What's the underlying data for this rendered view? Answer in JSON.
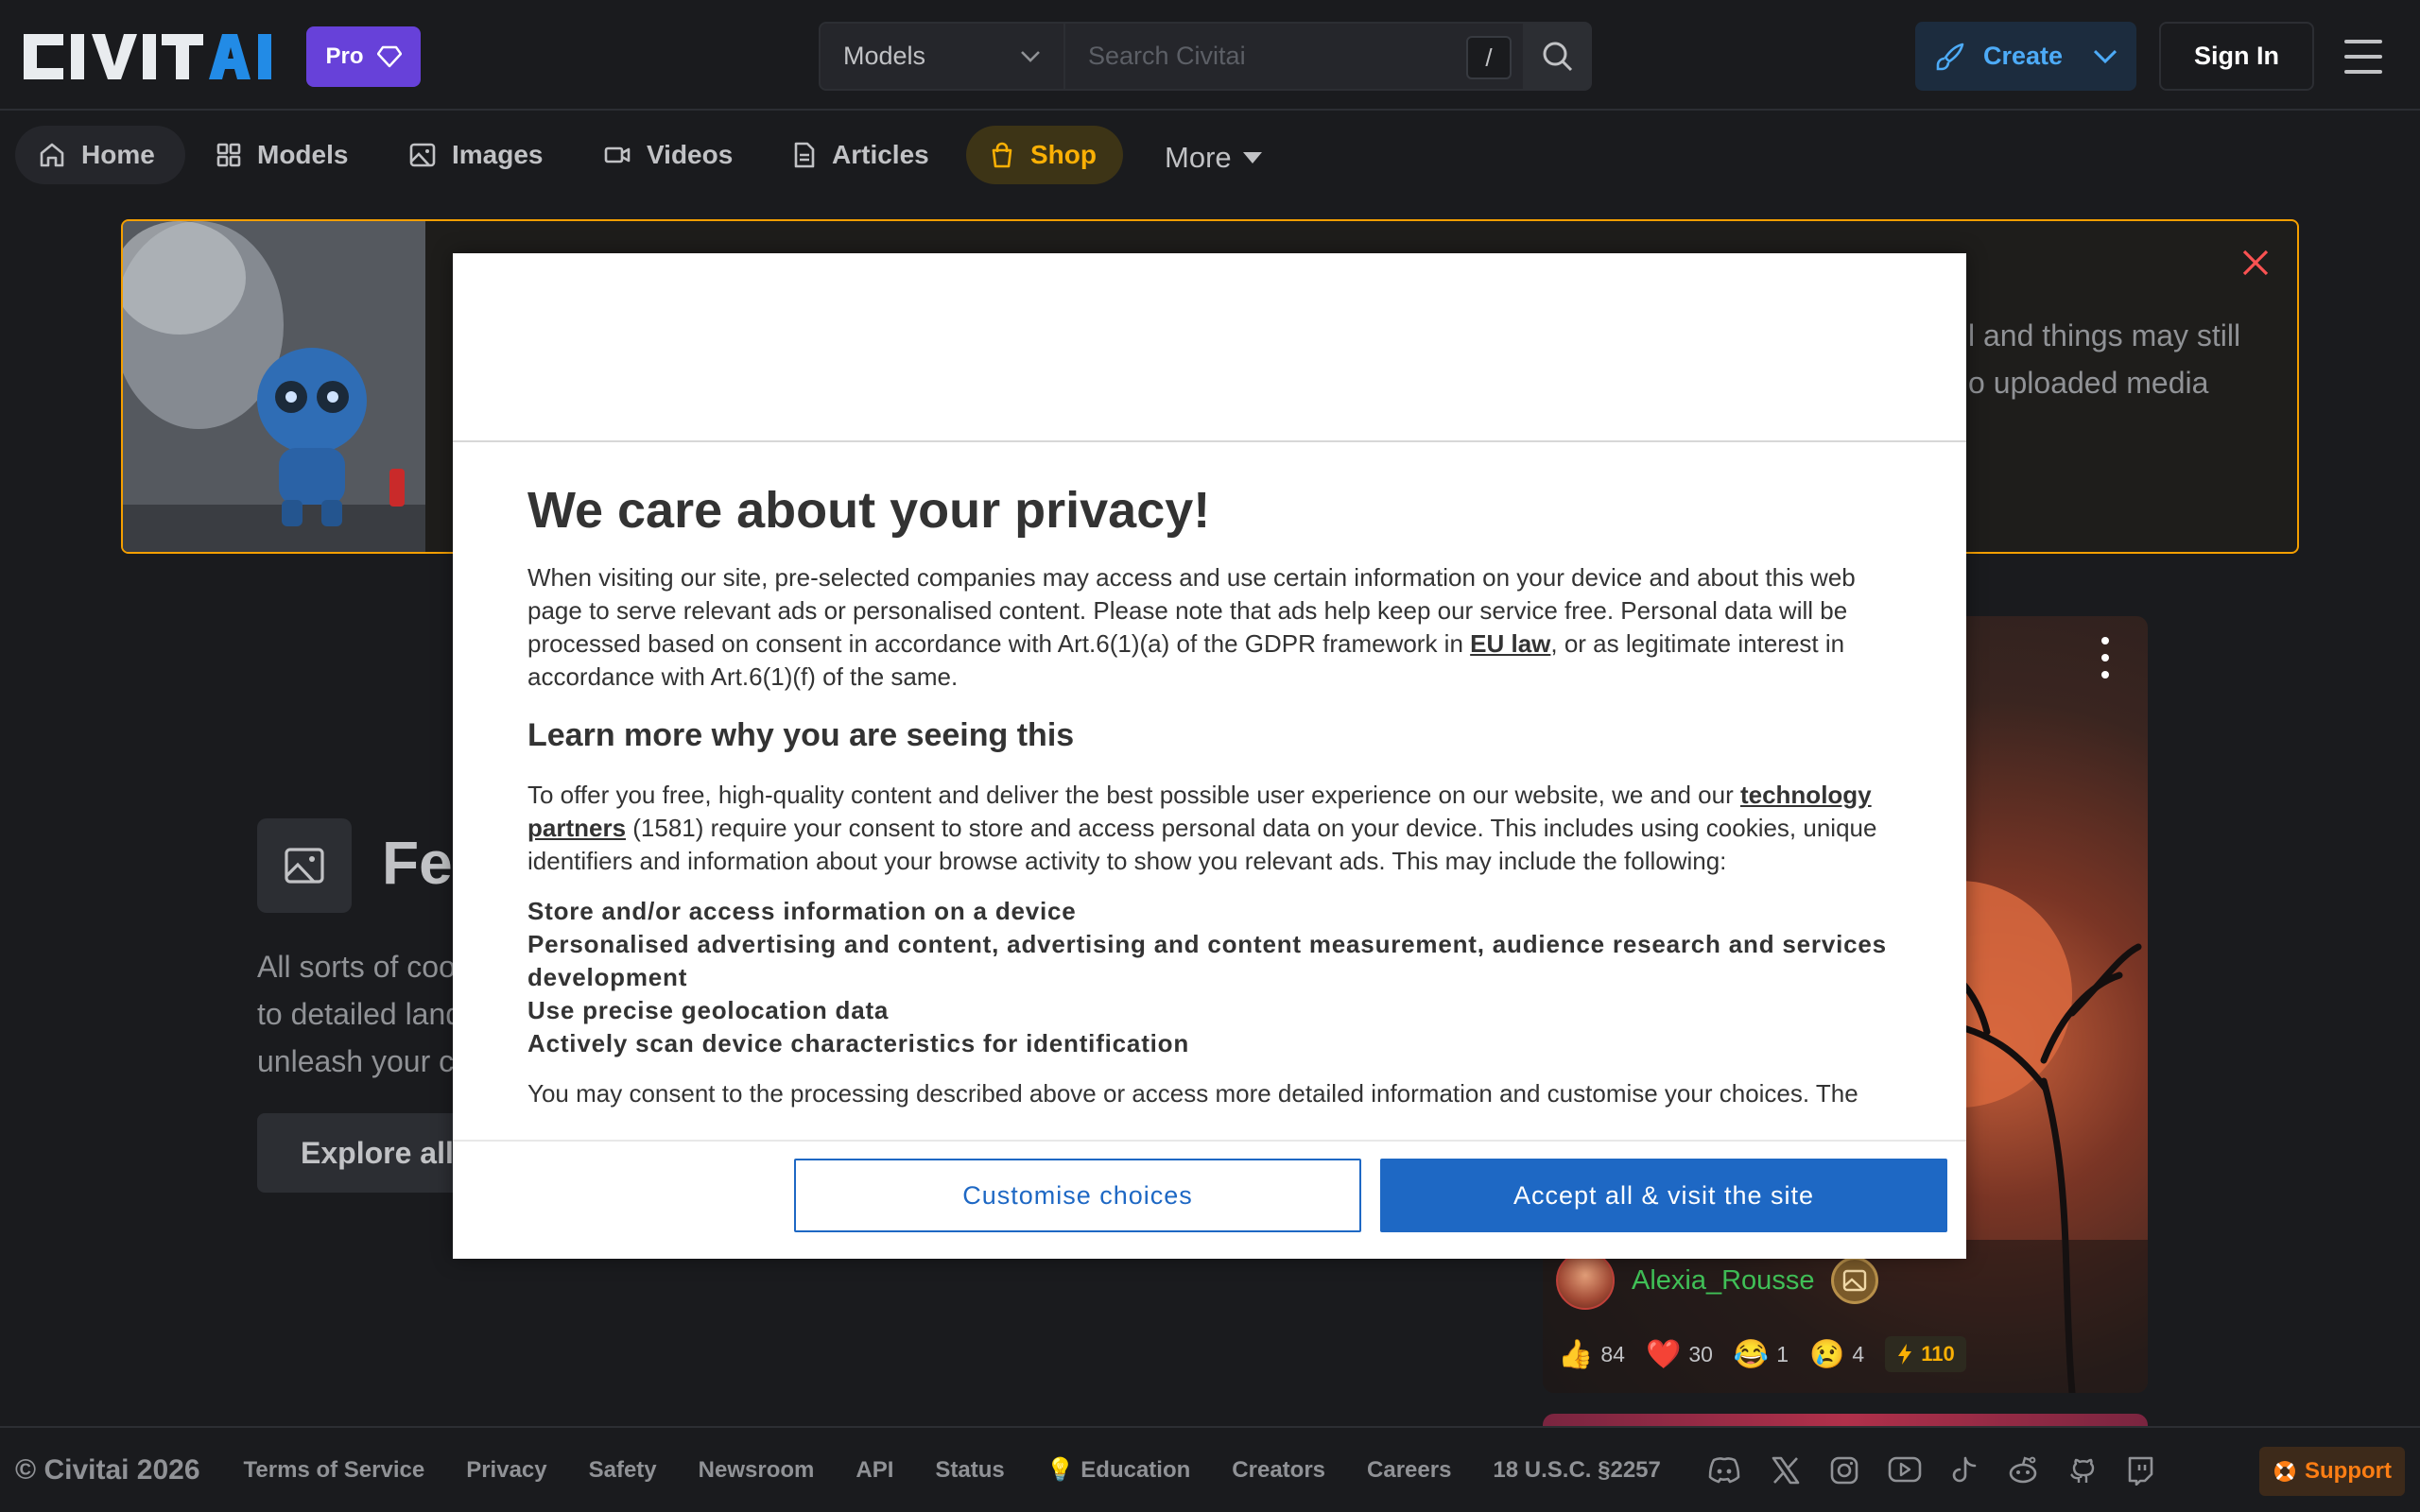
{
  "header": {
    "logo_text": "CIVITAI",
    "pro_label": "Pro",
    "search_scope": "Models",
    "search_placeholder": "Search Civitai",
    "search_shortcut": "/",
    "create_label": "Create",
    "signin_label": "Sign In"
  },
  "nav": {
    "items": [
      {
        "label": "Home",
        "icon": "home-icon"
      },
      {
        "label": "Models",
        "icon": "grid-icon"
      },
      {
        "label": "Images",
        "icon": "photo-icon"
      },
      {
        "label": "Videos",
        "icon": "video-icon"
      },
      {
        "label": "Articles",
        "icon": "article-icon"
      },
      {
        "label": "Shop",
        "icon": "shopping-bag-icon"
      }
    ],
    "more_label": "More"
  },
  "banner": {
    "text_line1": "l and things may still",
    "text_line2": "o uploaded media"
  },
  "featured": {
    "title": "Fea",
    "desc_line1": "All sorts of coo",
    "desc_line2": "to detailed land",
    "desc_line3": "unleash your c",
    "explore_label": "Explore all i"
  },
  "card": {
    "username": "Alexia_Rousse",
    "reactions": [
      {
        "emoji": "👍",
        "count": "84"
      },
      {
        "emoji": "❤️",
        "count": "30"
      },
      {
        "emoji": "😂",
        "count": "1"
      },
      {
        "emoji": "😢",
        "count": "4"
      }
    ],
    "buzz": "110"
  },
  "modal": {
    "title": "We care about your privacy!",
    "p1_before": "When visiting our site, pre-selected companies may access and use certain information on your device and about this web page to serve relevant ads or personalised content. Please note that ads help keep our service free. Personal data will be processed based on consent in accordance with Art.6(1)(a) of the GDPR framework in ",
    "p1_link": "EU law",
    "p1_after": ", or as legitimate interest in accordance with Art.6(1)(f) of the same.",
    "h2": "Learn more why you are seeing this",
    "p2_before": "To offer you free, high-quality content and deliver the best possible user experience on our website, we and our ",
    "p2_link": "technology partners",
    "p2_after": " (1581) require your consent to store and access personal data on your device. This includes using cookies, unique identifiers and information about your browse activity to show you relevant ads. This may include the following:",
    "purposes": [
      "Store and/or access information on a device",
      "Personalised advertising and content, advertising and content measurement, audience research and services development",
      "Use precise geolocation data",
      "Actively scan device characteristics for identification"
    ],
    "p3": "You may consent to the processing described above or access more detailed information and customise your choices. The",
    "customise_label": "Customise choices",
    "accept_label": "Accept all & visit the site"
  },
  "footer": {
    "copyright": "© Civitai 2026",
    "links": [
      "Terms of Service",
      "Privacy",
      "Safety",
      "Newsroom",
      "API",
      "Status",
      "💡 Education",
      "Creators",
      "Careers",
      "18 U.S.C. §2257"
    ],
    "social_icons": [
      "discord-icon",
      "x-icon",
      "instagram-icon",
      "youtube-icon",
      "tiktok-icon",
      "reddit-icon",
      "github-icon",
      "twitch-icon"
    ],
    "support_label": "Support"
  }
}
